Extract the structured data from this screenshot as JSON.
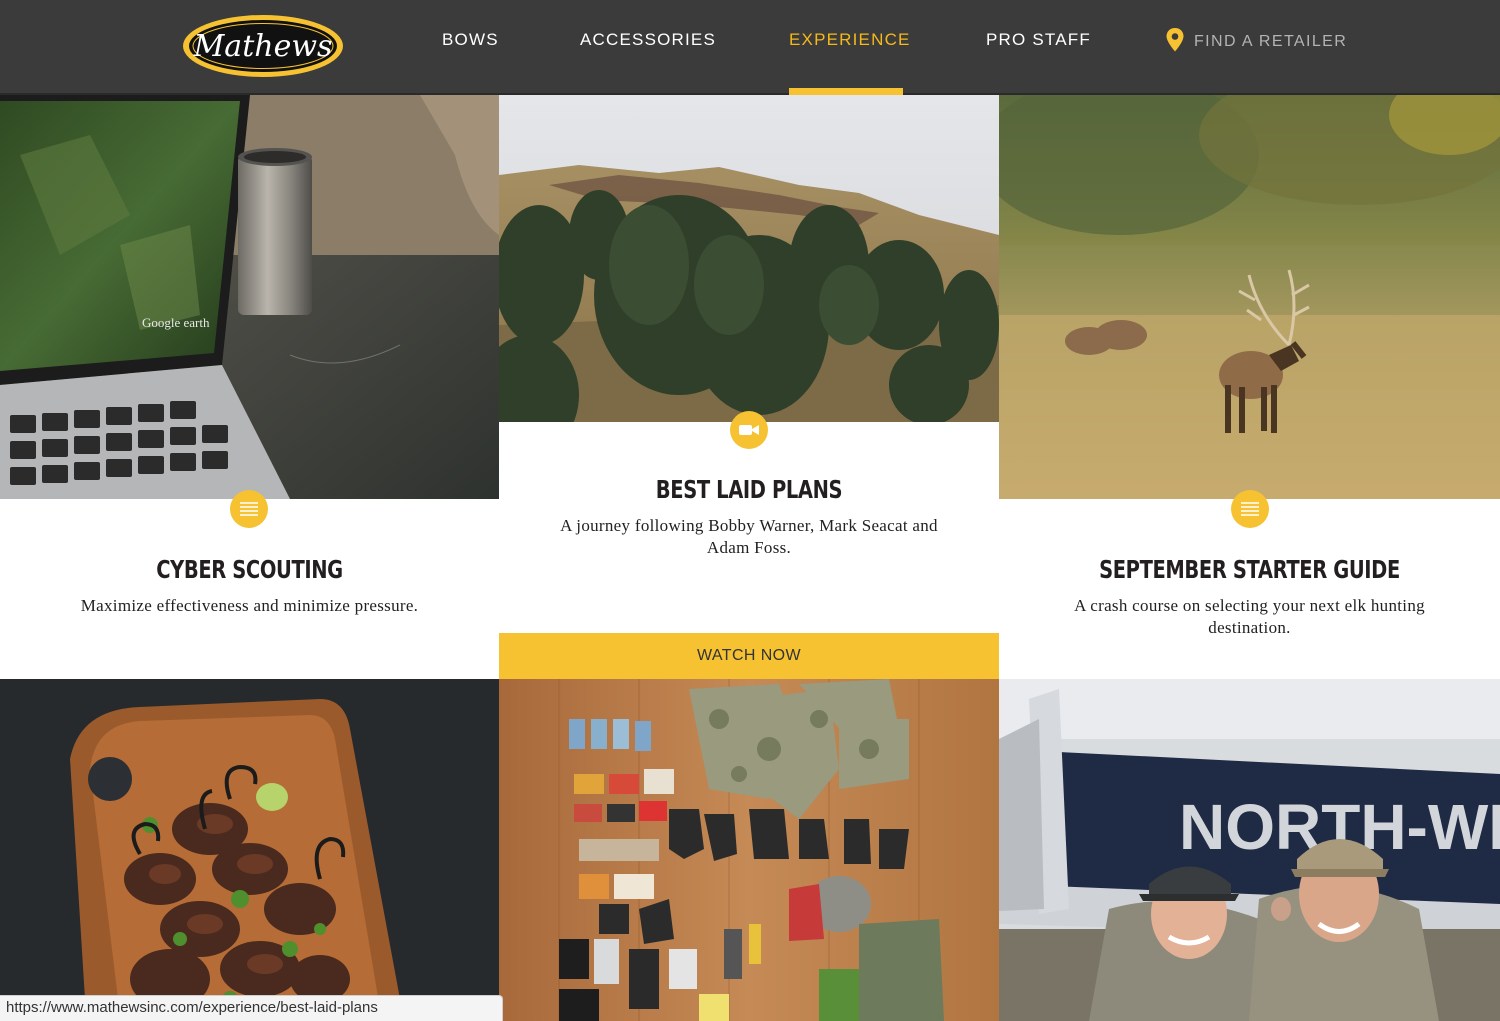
{
  "brand": {
    "logo_text": "Mathews"
  },
  "nav": {
    "items": [
      {
        "label": "BOWS"
      },
      {
        "label": "ACCESSORIES"
      },
      {
        "label": "EXPERIENCE"
      },
      {
        "label": "PRO STAFF"
      }
    ],
    "active": "EXPERIENCE",
    "retailer_label": "FIND A RETAILER",
    "retailer_icon": "map-pin-icon"
  },
  "cards": [
    {
      "title": "CYBER SCOUTING",
      "description": "Maximize effectiveness and minimize pressure.",
      "type_icon": "article-lines-icon",
      "image_subject": "laptop-map-and-mug"
    },
    {
      "title": "BEST LAID PLANS",
      "description": "A journey following Bobby Warner, Mark Seacat and Adam Foss.",
      "type_icon": "video-camera-icon",
      "cta": "WATCH NOW",
      "image_subject": "hillside-trees"
    },
    {
      "title": "SEPTEMBER STARTER GUIDE",
      "description": "A crash course on selecting your next elk hunting destination.",
      "type_icon": "article-lines-icon",
      "image_subject": "elk-in-field"
    }
  ],
  "bottom_tiles": [
    {
      "image_subject": "skewers-on-cutting-board"
    },
    {
      "image_subject": "gear-flat-lay"
    },
    {
      "image_subject": "hunters-by-plane"
    }
  ],
  "plane_text": "NORTH-WE",
  "status_url": "https://www.mathewsinc.com/experience/best-laid-plans",
  "colors": {
    "header_bg": "#3b3b3b",
    "accent": "#f6c232",
    "active_nav": "#f6b91b",
    "title_text": "#231f20"
  }
}
